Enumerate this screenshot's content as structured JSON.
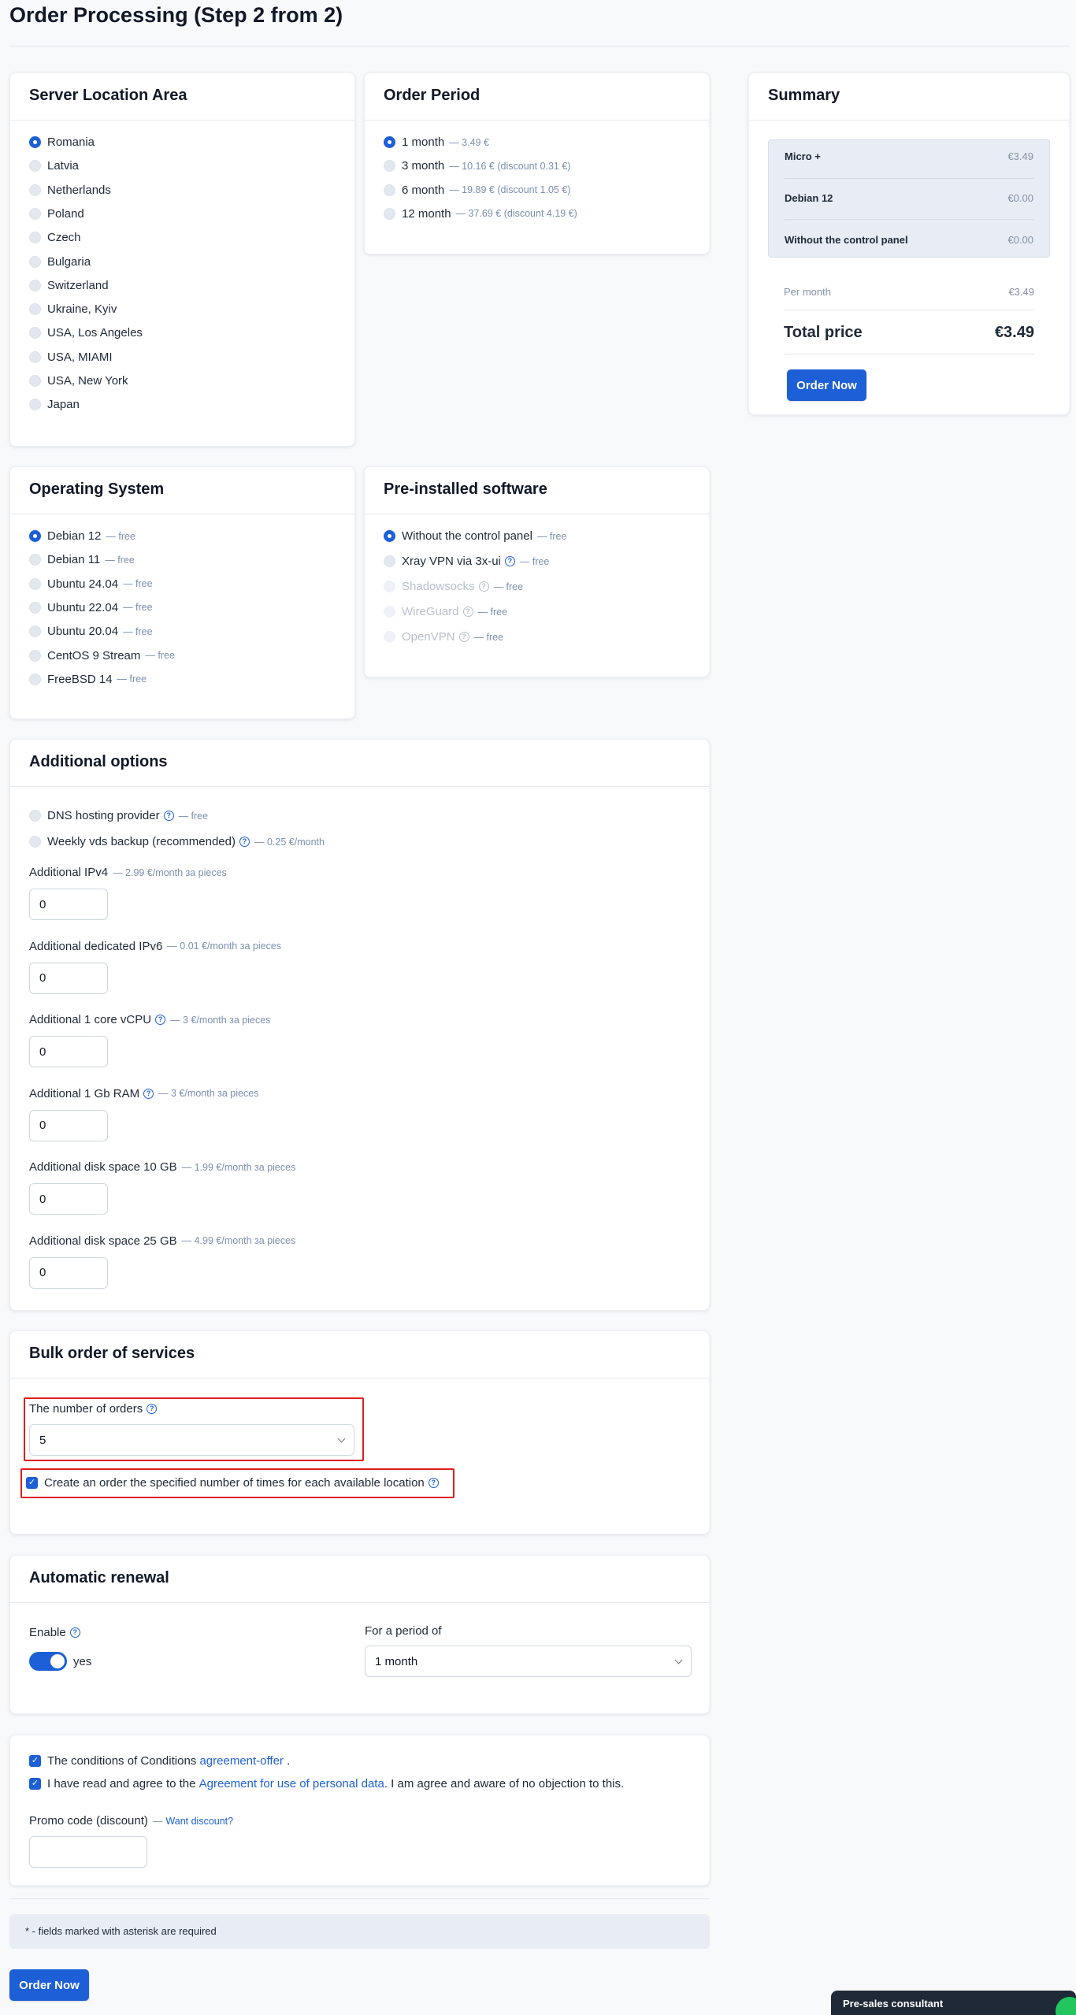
{
  "page": {
    "title": "Order Processing (Step 2 from 2)"
  },
  "location": {
    "title": "Server Location Area",
    "selected": 0,
    "items": [
      "Romania",
      "Latvia",
      "Netherlands",
      "Poland",
      "Czech",
      "Bulgaria",
      "Switzerland",
      "Ukraine, Kyiv",
      "USA, Los Angeles",
      "USA, MIAMI",
      "USA, New York",
      "Japan"
    ]
  },
  "period": {
    "title": "Order Period",
    "selected": 0,
    "items": [
      {
        "label": "1 month",
        "note": "— 3.49 €"
      },
      {
        "label": "3 month",
        "note": "— 10.16 € (discount 0.31 €)"
      },
      {
        "label": "6 month",
        "note": "— 19.89 € (discount 1.05 €)"
      },
      {
        "label": "12 month",
        "note": "— 37.69 € (discount 4.19 €)"
      }
    ]
  },
  "os": {
    "title": "Operating System",
    "selected": 0,
    "items": [
      {
        "label": "Debian 12",
        "note": "— free"
      },
      {
        "label": "Debian 11",
        "note": "— free"
      },
      {
        "label": "Ubuntu 24.04",
        "note": "— free"
      },
      {
        "label": "Ubuntu 22.04",
        "note": "— free"
      },
      {
        "label": "Ubuntu 20.04",
        "note": "— free"
      },
      {
        "label": "CentOS 9 Stream",
        "note": "— free"
      },
      {
        "label": "FreeBSD 14",
        "note": "— free"
      }
    ]
  },
  "software": {
    "title": "Pre-installed software",
    "selected": 0,
    "items": [
      {
        "label": "Without the control panel",
        "note": "— free",
        "help": false,
        "disabled": false
      },
      {
        "label": "Xray VPN via 3x-ui",
        "note": "— free",
        "help": true,
        "disabled": false
      },
      {
        "label": "Shadowsocks",
        "note": "— free",
        "help": true,
        "disabled": true
      },
      {
        "label": "WireGuard",
        "note": "— free",
        "help": true,
        "disabled": true
      },
      {
        "label": "OpenVPN",
        "note": "— free",
        "help": true,
        "disabled": true
      }
    ]
  },
  "options": {
    "title": "Additional options",
    "checks": [
      {
        "label": "DNS hosting provider",
        "note": "— free"
      },
      {
        "label": "Weekly vds backup (recommended)",
        "note": "— 0.25 €/month"
      }
    ],
    "fields": [
      {
        "label": "Additional IPv4",
        "note": "— 2.99 €/month за pieces",
        "help": false,
        "value": "0"
      },
      {
        "label": "Additional dedicated IPv6",
        "note": "— 0.01 €/month за pieces",
        "help": false,
        "value": "0"
      },
      {
        "label": "Additional 1 core vCPU",
        "note": "— 3 €/month за pieces",
        "help": true,
        "value": "0"
      },
      {
        "label": "Additional 1 Gb RAM",
        "note": "— 3 €/month за pieces",
        "help": true,
        "value": "0"
      },
      {
        "label": "Additional disk space 10 GB",
        "note": "— 1.99 €/month за pieces",
        "help": false,
        "value": "0"
      },
      {
        "label": "Additional disk space 25 GB",
        "note": "— 4.99 €/month за pieces",
        "help": false,
        "value": "0"
      }
    ]
  },
  "bulk": {
    "title": "Bulk order of services",
    "count_label": "The number of orders",
    "count_value": "5",
    "each_location_label": "Create an order the specified number of times for each available location"
  },
  "renewal": {
    "title": "Automatic renewal",
    "enable_label": "Enable",
    "toggle_text": "yes",
    "period_label": "For a period of",
    "period_value": "1 month"
  },
  "agree": {
    "conditions_text": "The conditions of Conditions",
    "conditions_link": "agreement-offer",
    "conditions_tail": ".",
    "personal_text": "I have read and agree to the",
    "personal_link": "Agreement for use of personal data",
    "personal_tail": ". I am agree and aware of no objection to this.",
    "promo_label": "Promo code (discount)",
    "promo_dash": "—",
    "promo_link": "Want discount?",
    "promo_value": ""
  },
  "required_note": "* - fields marked with asterisk are required",
  "order_button": "Order Now",
  "summary": {
    "title": "Summary",
    "lines": [
      {
        "k": "Micro +",
        "v": "€3.49"
      },
      {
        "k": "Debian 12",
        "v": "€0.00"
      },
      {
        "k": "Without the control panel",
        "v": "€0.00"
      }
    ],
    "per_month_label": "Per month",
    "per_month_value": "€3.49",
    "total_label": "Total price",
    "total_value": "€3.49",
    "button": "Order Now"
  },
  "chat": {
    "label": "Pre-sales consultant"
  },
  "colors": {
    "accent": "#1d5fd6",
    "highlight": "#e01e1e",
    "chat_bar": "#1f2937",
    "chat_badge": "#22c55e"
  }
}
